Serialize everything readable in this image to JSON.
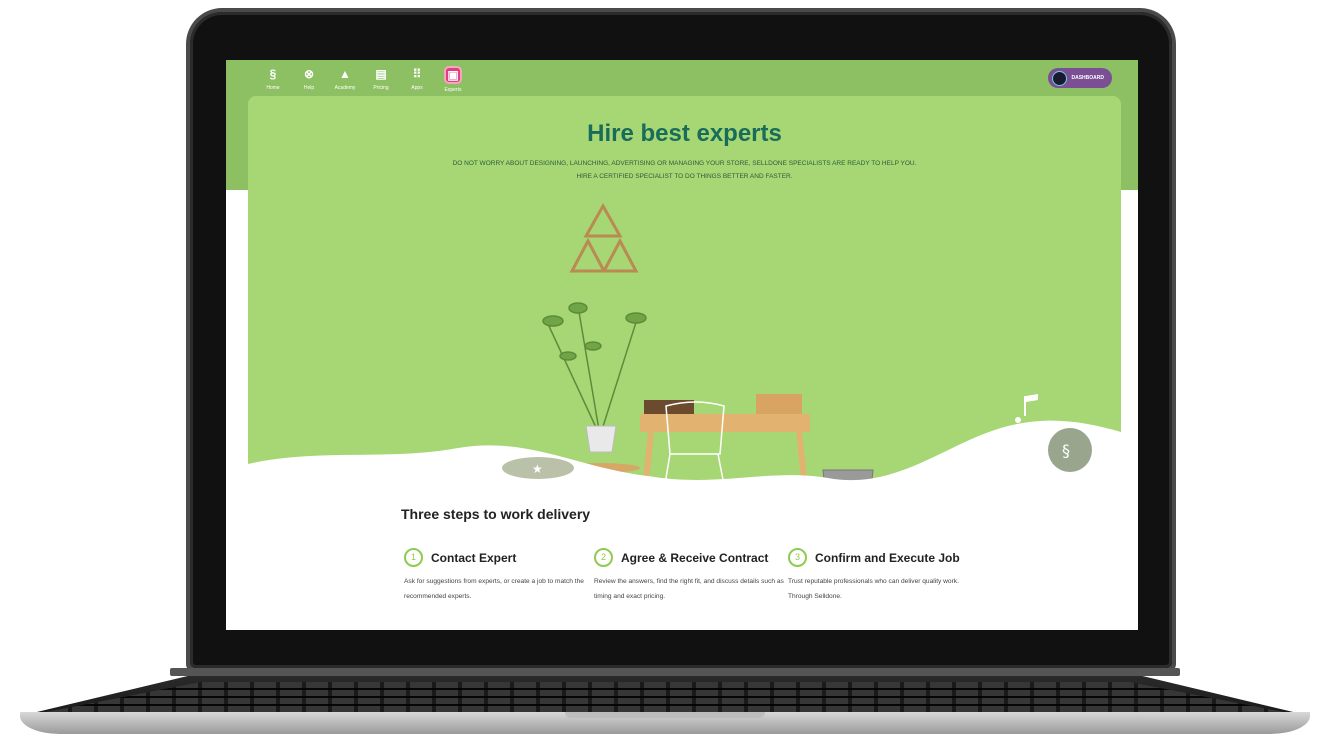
{
  "nav": {
    "items": [
      {
        "label": "Home",
        "icon": "logo-icon"
      },
      {
        "label": "Help",
        "icon": "help-icon"
      },
      {
        "label": "Academy",
        "icon": "graduation-cap-icon"
      },
      {
        "label": "Pricing",
        "icon": "calculator-icon"
      },
      {
        "label": "Apps",
        "icon": "grid-icon"
      },
      {
        "label": "Experts",
        "icon": "experts-icon"
      }
    ],
    "dashboard_label": "DASHBOARD"
  },
  "hero": {
    "title": "Hire best experts",
    "subtitle_line1": "DO NOT WORRY ABOUT DESIGNING, LAUNCHING, ADVERTISING OR MANAGING YOUR STORE, SELLDONE SPECIALISTS ARE READY TO HELP YOU.",
    "subtitle_line2": "HIRE A CERTIFIED SPECIALIST TO DO THINGS BETTER AND FASTER."
  },
  "steps": {
    "title": "Three steps to work delivery",
    "items": [
      {
        "num": "1",
        "title": "Contact Expert",
        "text": "Ask for suggestions from experts, or create a job to match the recommended experts."
      },
      {
        "num": "2",
        "title": "Agree & Receive Contract",
        "text": "Review the answers, find the right fit, and discuss details such as timing and exact pricing."
      },
      {
        "num": "3",
        "title": "Confirm and Execute Job",
        "text": "Trust reputable professionals who can deliver quality work. Through Selldone."
      }
    ]
  },
  "colors": {
    "accent": "#8ecb4e",
    "title": "#196c5a",
    "hero_bg": "#a6d774",
    "band": "#8cc063",
    "active": "#e0417a",
    "dashboard": "#7b4f94"
  }
}
